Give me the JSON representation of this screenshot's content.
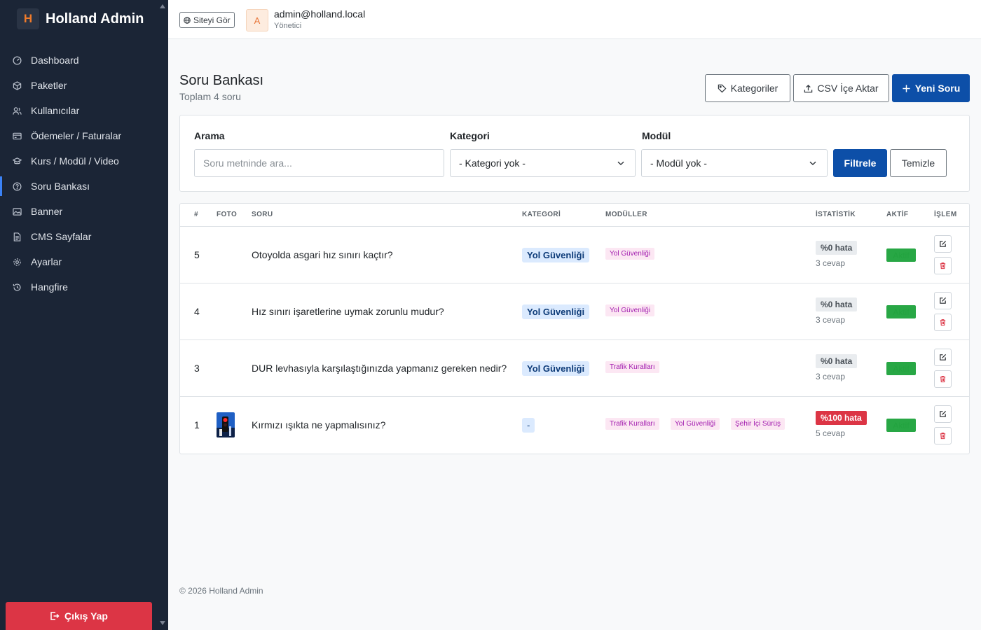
{
  "brand": {
    "logo_letter": "H",
    "title": "Holland Admin"
  },
  "sidebar": {
    "items": [
      {
        "label": "Dashboard",
        "icon": "dashboard-icon"
      },
      {
        "label": "Paketler",
        "icon": "package-icon"
      },
      {
        "label": "Kullanıcılar",
        "icon": "users-icon"
      },
      {
        "label": "Ödemeler / Faturalar",
        "icon": "payments-icon"
      },
      {
        "label": "Kurs / Modül / Video",
        "icon": "course-icon"
      },
      {
        "label": "Soru Bankası",
        "icon": "question-icon",
        "active": true
      },
      {
        "label": "Banner",
        "icon": "banner-icon"
      },
      {
        "label": "CMS Sayfalar",
        "icon": "document-icon"
      },
      {
        "label": "Ayarlar",
        "icon": "gear-icon"
      },
      {
        "label": "Hangfire",
        "icon": "history-icon"
      }
    ],
    "logout_label": "Çıkış Yap"
  },
  "topbar": {
    "view_site_label": "Siteyi Gör",
    "avatar_letter": "A",
    "user_email": "admin@holland.local",
    "user_role": "Yönetici"
  },
  "page": {
    "title": "Soru Bankası",
    "subtitle": "Toplam 4 soru",
    "categories_button": "Kategoriler",
    "csv_button": "CSV İçe Aktar",
    "new_button": "Yeni Soru"
  },
  "filters": {
    "search_label": "Arama",
    "search_placeholder": "Soru metninde ara...",
    "category_label": "Kategori",
    "category_value": "- Kategori yok -",
    "module_label": "Modül",
    "module_value": "- Modül yok -",
    "filter_button": "Filtrele",
    "clear_button": "Temizle"
  },
  "table": {
    "headers": [
      "#",
      "FOTO",
      "SORU",
      "KATEGORİ",
      "MODÜLLER",
      "İSTATİSTİK",
      "AKTİF",
      "İŞLEM"
    ],
    "rows": [
      {
        "id": "5",
        "has_photo": false,
        "question": "Otoyolda asgari hız sınırı kaçtır?",
        "category": "Yol Güvenliği",
        "modules": [
          "Yol Güvenliği"
        ],
        "stat": "%0 hata",
        "stat_level": "ok",
        "answers": "3 cevap",
        "active": "Aktif"
      },
      {
        "id": "4",
        "has_photo": false,
        "question": "Hız sınırı işaretlerine uymak zorunlu mudur?",
        "category": "Yol Güvenliği",
        "modules": [
          "Yol Güvenliği"
        ],
        "stat": "%0 hata",
        "stat_level": "ok",
        "answers": "3 cevap",
        "active": "Aktif"
      },
      {
        "id": "3",
        "has_photo": false,
        "question": "DUR levhasıyla karşılaştığınızda yapmanız gereken nedir?",
        "category": "Yol Güvenliği",
        "modules": [
          "Trafik Kuralları"
        ],
        "stat": "%0 hata",
        "stat_level": "ok",
        "answers": "3 cevap",
        "active": "Aktif"
      },
      {
        "id": "1",
        "has_photo": true,
        "question": "Kırmızı ışıkta ne yapmalısınız?",
        "category": "-",
        "modules": [
          "Trafik Kuralları",
          "Yol Güvenliği",
          "Şehir İçi Sürüş"
        ],
        "stat": "%100 hata",
        "stat_level": "bad",
        "answers": "5 cevap",
        "active": "Aktif"
      }
    ]
  },
  "footer": {
    "text": "© 2026 Holland Admin"
  },
  "colors": {
    "sidebar_bg": "#1b2536",
    "primary": "#0d4fa8",
    "danger": "#dc3545",
    "success": "#28a745",
    "brand_orange": "#f07b2b"
  }
}
